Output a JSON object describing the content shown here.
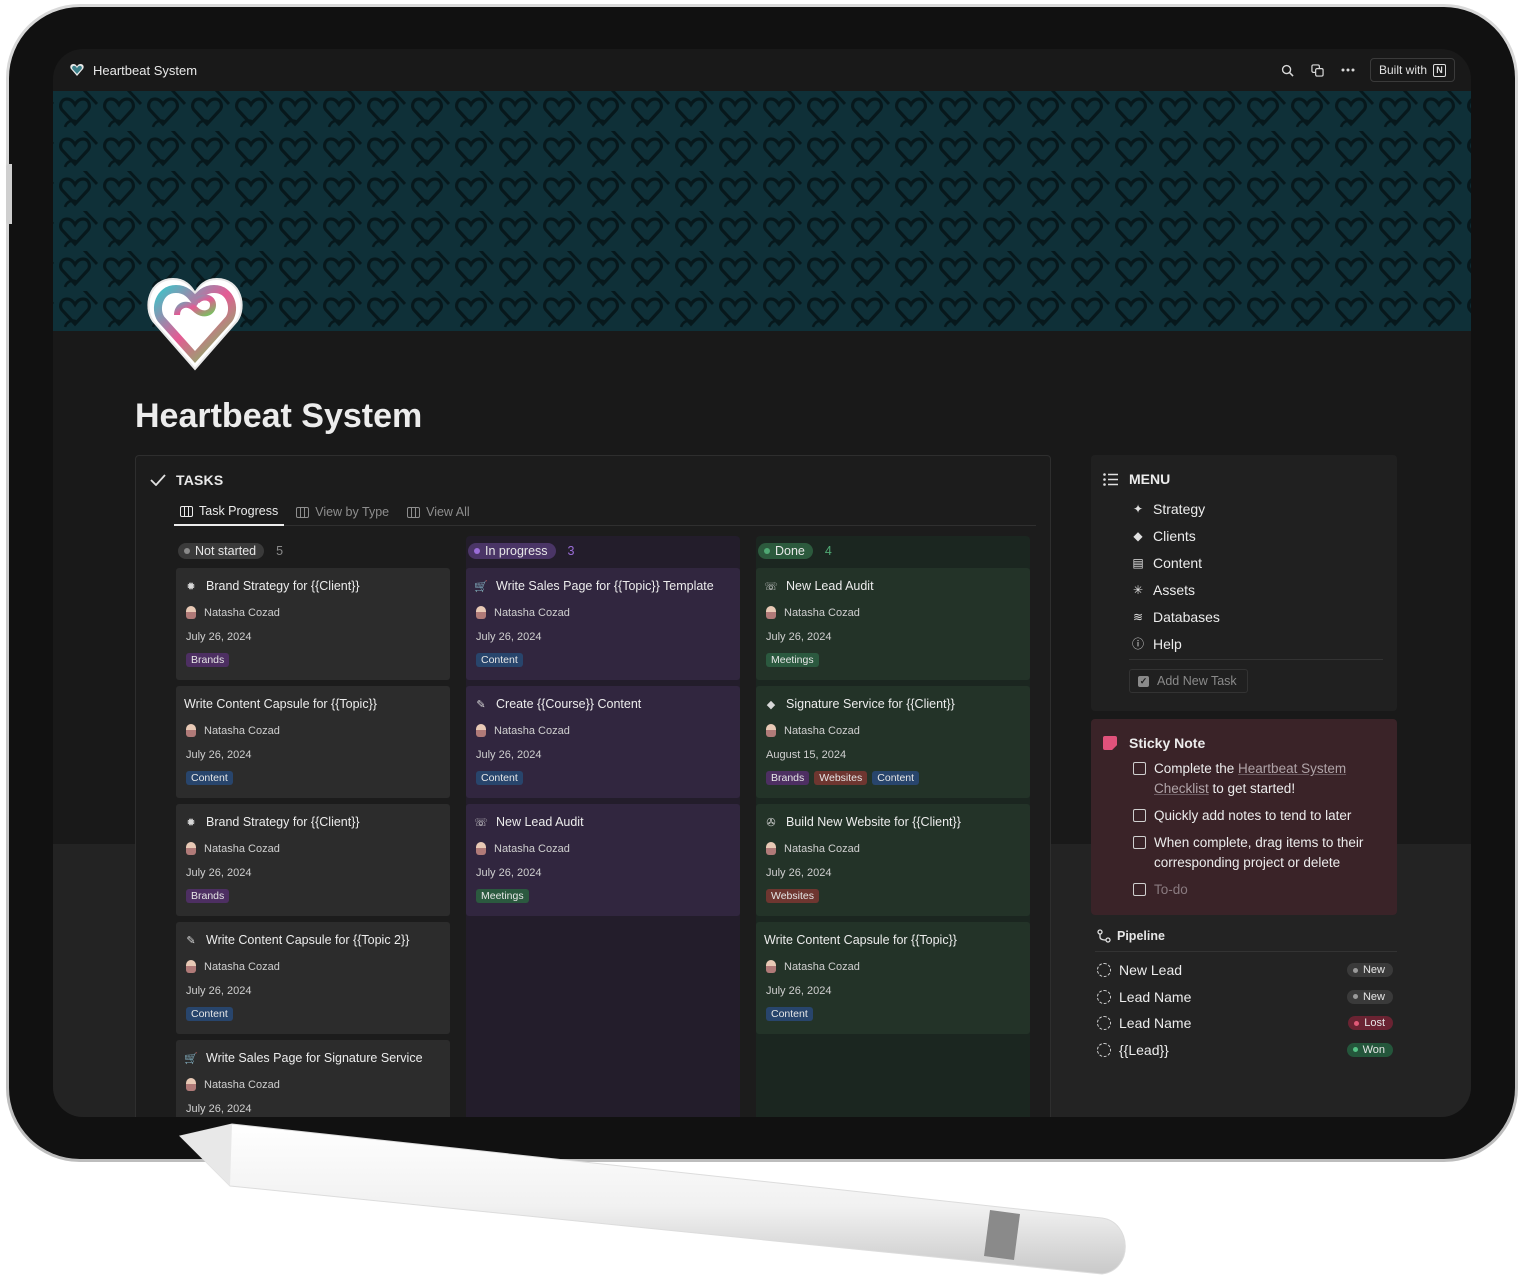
{
  "window": {
    "breadcrumb": "Heartbeat System",
    "built_with": "Built with",
    "built_with_badge": "N"
  },
  "page": {
    "title": "Heartbeat System"
  },
  "tasks": {
    "heading": "TASKS",
    "tabs": [
      {
        "label": "Task Progress",
        "active": true
      },
      {
        "label": "View by Type",
        "active": false
      },
      {
        "label": "View All",
        "active": false
      }
    ],
    "columns": [
      {
        "status": "Not started",
        "count": "5",
        "color": "#8a8a8a",
        "cards": [
          {
            "title": "Brand Strategy for {{Client}}",
            "icon": "strategy-icon",
            "assignee": "Natasha Cozad",
            "date": "July 26, 2024",
            "tags": [
              {
                "label": "Brands",
                "color": "#4d2f62"
              }
            ]
          },
          {
            "title": "Write Content Capsule for {{Topic}}",
            "icon": "",
            "assignee": "Natasha Cozad",
            "date": "July 26, 2024",
            "tags": [
              {
                "label": "Content",
                "color": "#28456c"
              }
            ]
          },
          {
            "title": "Brand Strategy for {{Client}}",
            "icon": "strategy-icon",
            "assignee": "Natasha Cozad",
            "date": "July 26, 2024",
            "tags": [
              {
                "label": "Brands",
                "color": "#4d2f62"
              }
            ]
          },
          {
            "title": "Write Content Capsule for {{Topic 2}}",
            "icon": "edit-icon",
            "assignee": "Natasha Cozad",
            "date": "July 26, 2024",
            "tags": [
              {
                "label": "Content",
                "color": "#28456c"
              }
            ]
          },
          {
            "title": "Write Sales Page for Signature Service",
            "icon": "cart-icon",
            "assignee": "Natasha Cozad",
            "date": "July 26, 2024",
            "tags": []
          }
        ]
      },
      {
        "status": "In progress",
        "count": "3",
        "color": "#9a6dd7",
        "cards": [
          {
            "title": "Write Sales Page for {{Topic}} Template",
            "icon": "cart-icon",
            "assignee": "Natasha Cozad",
            "date": "July 26, 2024",
            "tags": [
              {
                "label": "Content",
                "color": "#28456c"
              }
            ]
          },
          {
            "title": "Create {{Course}} Content",
            "icon": "edit-icon",
            "assignee": "Natasha Cozad",
            "date": "July 26, 2024",
            "tags": [
              {
                "label": "Content",
                "color": "#28456c"
              }
            ]
          },
          {
            "title": "New Lead Audit",
            "icon": "phone-icon",
            "assignee": "Natasha Cozad",
            "date": "July 26, 2024",
            "tags": [
              {
                "label": "Meetings",
                "color": "#2b593f"
              }
            ]
          }
        ]
      },
      {
        "status": "Done",
        "count": "4",
        "color": "#4fa873",
        "cards": [
          {
            "title": "New Lead Audit",
            "icon": "phone-icon",
            "assignee": "Natasha Cozad",
            "date": "July 26, 2024",
            "tags": [
              {
                "label": "Meetings",
                "color": "#2b593f"
              }
            ]
          },
          {
            "title": "Signature Service for {{Client}}",
            "icon": "gem-icon",
            "assignee": "Natasha Cozad",
            "date": "August 15, 2024",
            "tags": [
              {
                "label": "Brands",
                "color": "#4d2f62"
              },
              {
                "label": "Websites",
                "color": "#6e3630"
              },
              {
                "label": "Content",
                "color": "#28456c"
              }
            ]
          },
          {
            "title": "Build New Website for {{Client}}",
            "icon": "compass-icon",
            "assignee": "Natasha Cozad",
            "date": "July 26, 2024",
            "tags": [
              {
                "label": "Websites",
                "color": "#6e3630"
              }
            ]
          },
          {
            "title": "Write Content Capsule for {{Topic}}",
            "icon": "",
            "assignee": "Natasha Cozad",
            "date": "July 26, 2024",
            "tags": [
              {
                "label": "Content",
                "color": "#28456c"
              }
            ]
          }
        ]
      }
    ]
  },
  "menu": {
    "heading": "MENU",
    "items": [
      {
        "label": "Strategy",
        "icon": "sparkle-icon"
      },
      {
        "label": "Clients",
        "icon": "gem-icon"
      },
      {
        "label": "Content",
        "icon": "archive-icon"
      },
      {
        "label": "Assets",
        "icon": "asterisk-icon"
      },
      {
        "label": "Databases",
        "icon": "database-icon"
      },
      {
        "label": "Help",
        "icon": "info-icon"
      }
    ],
    "add_task": "Add New Task"
  },
  "sticky": {
    "heading": "Sticky Note",
    "todo1_a": "Complete the ",
    "todo1_link": "Heartbeat System Checklist",
    "todo1_b": " to get started!",
    "todo2": "Quickly add notes to tend to later",
    "todo3": "When complete, drag items to their corresponding project or delete",
    "todo4": "To-do"
  },
  "pipeline": {
    "heading": "Pipeline",
    "rows": [
      {
        "name": "New Lead",
        "status": "New",
        "status_bg": "#3a3a3a",
        "dot": "#9a9a9a"
      },
      {
        "name": "Lead Name",
        "status": "New",
        "status_bg": "#3a3a3a",
        "dot": "#9a9a9a"
      },
      {
        "name": "Lead Name",
        "status": "Lost",
        "status_bg": "#6a2332",
        "dot": "#e05a78"
      },
      {
        "name": "{{Lead}}",
        "status": "Won",
        "status_bg": "#24563b",
        "dot": "#54c285"
      }
    ]
  }
}
